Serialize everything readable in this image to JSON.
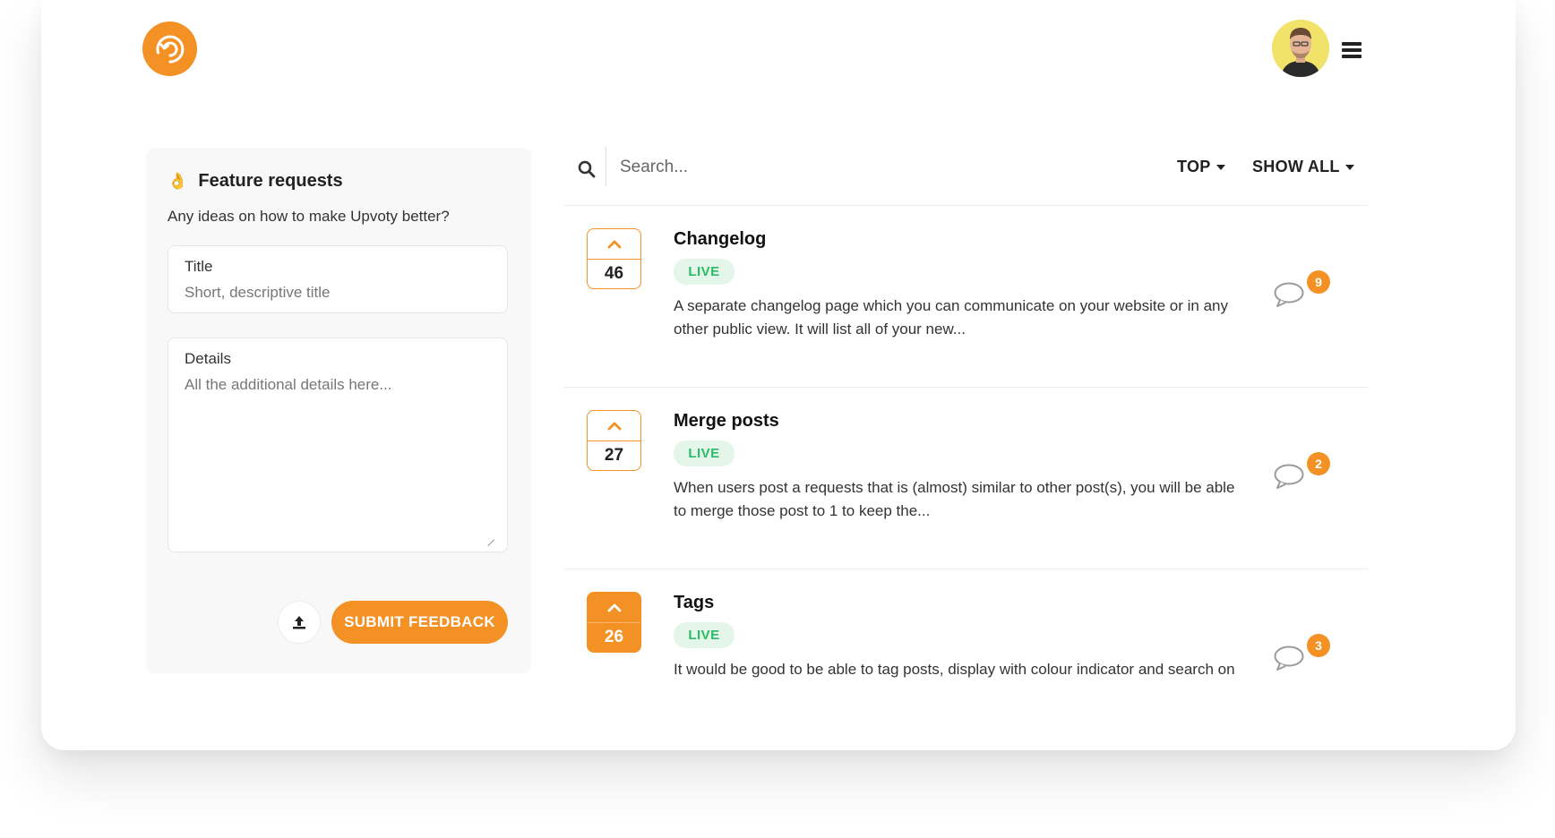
{
  "header": {
    "logo_name": "upvoty-logo",
    "avatar_name": "user-avatar"
  },
  "panel": {
    "title": "Feature requests",
    "emoji": "👌",
    "subtitle": "Any ideas on how to make Upvoty better?",
    "title_field": {
      "label": "Title",
      "placeholder": "Short, descriptive title"
    },
    "details_field": {
      "label": "Details",
      "placeholder": "All the additional details here..."
    },
    "submit_label": "SUBMIT FEEDBACK"
  },
  "search": {
    "placeholder": "Search..."
  },
  "filters": {
    "sort_label": "TOP",
    "show_label": "SHOW ALL"
  },
  "posts": [
    {
      "title": "Changelog",
      "votes": "46",
      "status": "LIVE",
      "description": "A separate changelog page which you can communicate on your website or in any other public view. It will list all of your new...",
      "comments": "9",
      "voted": false
    },
    {
      "title": "Merge posts",
      "votes": "27",
      "status": "LIVE",
      "description": "When users post a requests that is (almost) similar to other post(s), you will be able to merge those post to 1 to keep the...",
      "comments": "2",
      "voted": false
    },
    {
      "title": "Tags",
      "votes": "26",
      "status": "LIVE",
      "description": "It would be good to be able to tag posts, display with colour indicator and search on",
      "comments": "3",
      "voted": true
    }
  ],
  "colors": {
    "accent": "#f39125",
    "live_text": "#2dbb66",
    "live_bg": "#e3f6e9"
  }
}
